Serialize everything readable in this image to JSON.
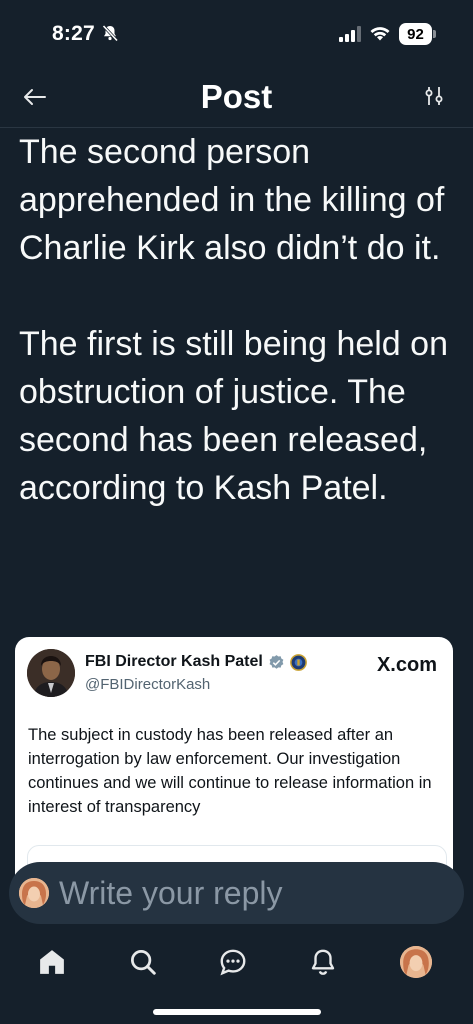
{
  "status_bar": {
    "time": "8:27",
    "battery": "92"
  },
  "header": {
    "title": "Post"
  },
  "post": {
    "text": "The second person apprehended in the killing of Charlie Kirk also didn’t do it.\n\nThe first is still being held on obstruction of justice. The second has been released, according to Kash Patel."
  },
  "quote": {
    "author_name": "FBI Director Kash Patel",
    "handle": "@FBIDirectorKash",
    "source": "X.com",
    "text": "The subject in custody has been released after an interrogation by law enforcement.  Our investigation continues and we will continue to release information in interest of transparency"
  },
  "reply": {
    "placeholder": "Write your reply"
  },
  "colors": {
    "background": "#15202b",
    "accent": "#1d9bf0",
    "muted": "#8b98a5"
  },
  "icons": [
    "back-arrow-icon",
    "filter-icon",
    "verified-badge-icon",
    "fbi-seal-icon",
    "home-icon",
    "search-icon",
    "chat-icon",
    "bell-icon"
  ]
}
